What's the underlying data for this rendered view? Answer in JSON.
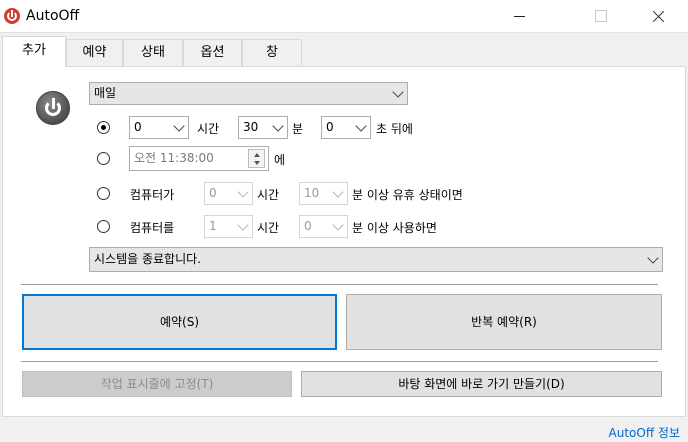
{
  "window": {
    "title": "AutoOff"
  },
  "tabs": [
    {
      "label": "추가",
      "active": true
    },
    {
      "label": "예약",
      "active": false
    },
    {
      "label": "상태",
      "active": false
    },
    {
      "label": "옵션",
      "active": false
    },
    {
      "label": "창",
      "active": false
    }
  ],
  "schedule": {
    "frequency": "매일"
  },
  "option_after": {
    "hours": "0",
    "hours_unit": "시간",
    "minutes": "30",
    "minutes_unit": "분",
    "seconds": "0",
    "seconds_suffix": "초 뒤에",
    "selected": true
  },
  "option_at": {
    "time_value": "오전 11:38:00",
    "suffix": "에",
    "selected": false
  },
  "option_idle": {
    "prefix": "컴퓨터가",
    "hours": "0",
    "hours_unit": "시간",
    "minutes": "10",
    "suffix": "분 이상 유휴 상태이면",
    "selected": false
  },
  "option_used": {
    "prefix": "컴퓨터를",
    "hours": "1",
    "hours_unit": "시간",
    "minutes": "0",
    "suffix": "분 이상 사용하면",
    "selected": false
  },
  "action": {
    "value": "시스템을 종료합니다."
  },
  "buttons": {
    "schedule": "예약(S)",
    "repeat_schedule": "반복 예약(R)",
    "pin_taskbar": "작업 표시줄에 고정(T)",
    "desktop_shortcut": "바탕 화면에 바로 가기 만들기(D)"
  },
  "footer": {
    "about_link": "AutoOff 정보"
  },
  "colors": {
    "accent": "#0078d7",
    "link": "#0066cc",
    "app_icon": "#d33a2f"
  }
}
